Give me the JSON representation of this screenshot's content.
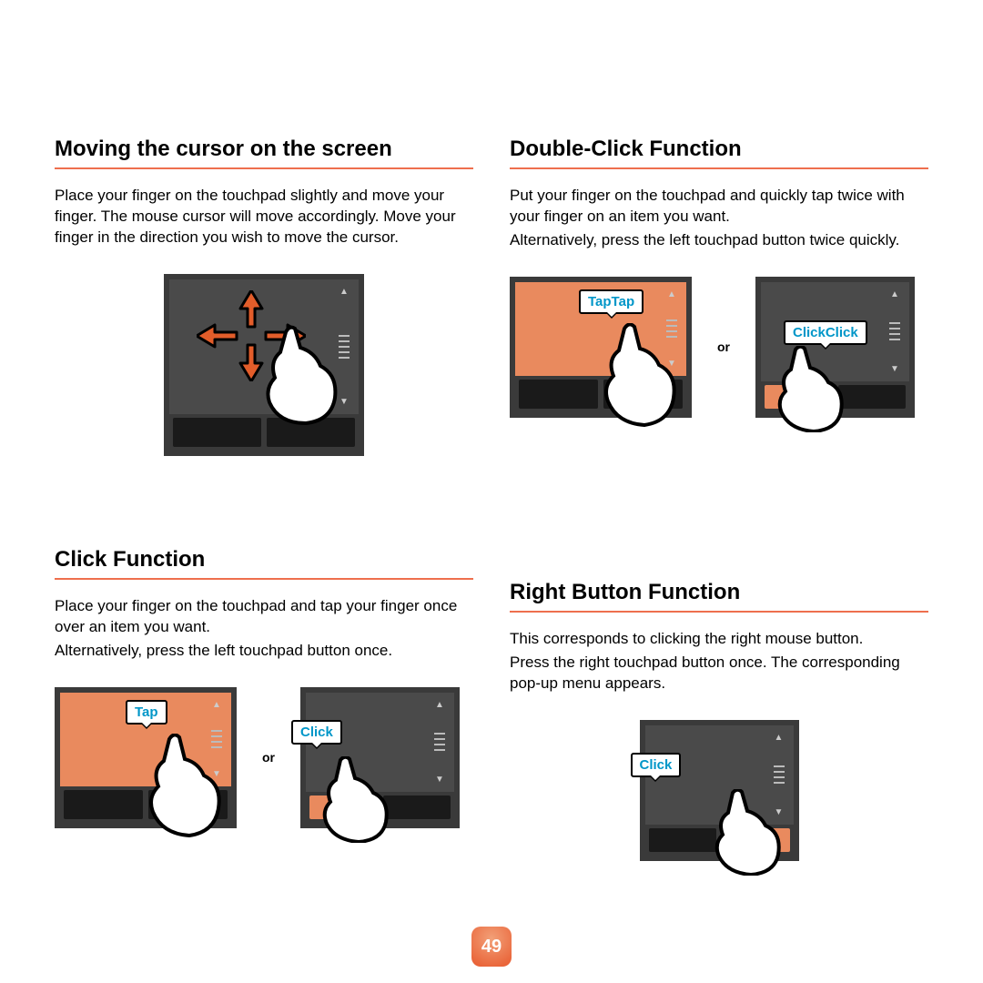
{
  "page_number": "49",
  "sections": {
    "moving": {
      "title": "Moving the cursor on the screen",
      "body": "Place your finger on the touchpad slightly and move your finger. The mouse cursor will move accordingly. Move your finger in the direction you wish to move the cursor."
    },
    "double_click": {
      "title": "Double-Click Function",
      "body1": "Put your finger on the touchpad and quickly tap twice with your finger on an item you want.",
      "body2": "Alternatively, press the left touchpad button twice quickly.",
      "label_tap": "TapTap",
      "label_click": "ClickClick",
      "or": "or"
    },
    "click": {
      "title": "Click Function",
      "body1": "Place your finger on the touchpad and tap your finger once over an item you want.",
      "body2": "Alternatively, press the left touchpad button once.",
      "label_tap": "Tap",
      "label_click": "Click",
      "or": "or"
    },
    "right_button": {
      "title": "Right Button Function",
      "body1": "This corresponds to clicking the right mouse button.",
      "body2": "Press the right touchpad button once. The corresponding pop-up menu appears.",
      "label_click": "Click"
    }
  }
}
